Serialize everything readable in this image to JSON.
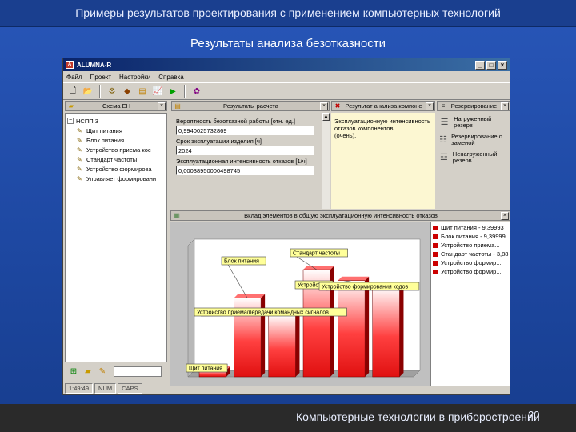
{
  "slide": {
    "header": "Примеры результатов проектирования с применением компьютерных технологий",
    "title": "Результаты анализа безотказности",
    "footer_text": "Компьютерные технологии в приборостроении",
    "page_number": "20"
  },
  "window": {
    "title": "ALUMNA-R",
    "menu": [
      "Файл",
      "Проект",
      "Настройки",
      "Справка"
    ],
    "toolbar_icons": [
      "new-file-icon",
      "open-folder-icon",
      "tools-icon",
      "component-icon",
      "report-icon",
      "chart-icon",
      "run-icon",
      "settings-icon"
    ]
  },
  "tree_panel": {
    "title": "Схема ЕН",
    "root": "НСПП 3",
    "items": [
      "Щит питания",
      "Блок питания",
      "Устройство приема кос",
      "Стандарт частоты",
      "Устройство формирова",
      "Управляет формировани"
    ]
  },
  "calc_panel": {
    "title": "Результаты расчета",
    "fields": [
      {
        "label": "Вероятность безотказной работы [отн. ед.]",
        "value": "0,9940025732869"
      },
      {
        "label": "Срок эксплуатации изделия [ч]",
        "value": "2024"
      },
      {
        "label": "Эксплуатационная интенсивность отказов [1/ч]",
        "value": "0,00038950000498745"
      }
    ]
  },
  "conclusion_panel": {
    "title": "Результат анализа компоне",
    "text": "Эксплуатационную интенсивность отказов компонентов ......... (очень)."
  },
  "redundancy_panel": {
    "title": "Резервирование",
    "items": [
      "Нагруженный резерв",
      "Резервирование с заменой",
      "Ненагруженный резерв"
    ]
  },
  "chart_panel": {
    "title": "Вклад элементов в общую эксплуатационную интенсивность отказов"
  },
  "chart_data": {
    "type": "bar",
    "title": "Вклад элементов в общую эксплуатационную интенсивность отказов",
    "categories": [
      "Щит питания",
      "Блок питания",
      "Устройство приема/передачи команд",
      "Стандарт частоты",
      "Устройство формирования",
      "Устройство формирования кодов"
    ],
    "values": [
      3,
      36,
      28,
      49,
      44,
      41
    ],
    "ylim": [
      0,
      60
    ],
    "xlabel": "",
    "ylabel": "",
    "grid": false,
    "bar_color": "#e01010",
    "callouts": [
      "Щит питания",
      "Блок питания",
      "Устройство приема/передачи командных сигналов",
      "Стандарт частоты",
      "Устройство",
      "Устройство формирования кодов"
    ]
  },
  "legend": {
    "items": [
      "Щит питания - 9,39993",
      "Блок питания - 9,39999",
      "Устройство приема...",
      "Стандарт частоты - 3,88",
      "Устройство формир...",
      "Устройство формир..."
    ]
  },
  "statusbar": {
    "time": "1:49:49",
    "num": "NUM",
    "caps": "CAPS"
  }
}
